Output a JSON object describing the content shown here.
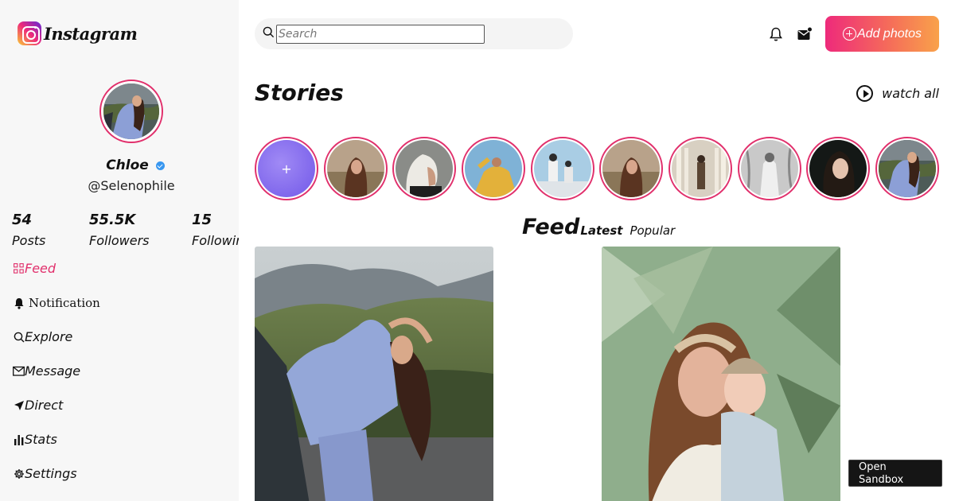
{
  "app": {
    "name": "Instagram"
  },
  "profile": {
    "name": "Chloe",
    "handle": "@Selenophile",
    "verified": true,
    "stats": [
      {
        "value": "54",
        "label": "Posts"
      },
      {
        "value": "55.5K",
        "label": "Followers"
      },
      {
        "value": "15",
        "label": "Following"
      }
    ]
  },
  "nav": [
    {
      "label": "Feed",
      "icon": "grid-icon",
      "active": true
    },
    {
      "label": "Notification",
      "icon": "bell-icon",
      "active": false
    },
    {
      "label": "Explore",
      "icon": "search-icon",
      "active": false
    },
    {
      "label": "Message",
      "icon": "mail-icon",
      "active": false
    },
    {
      "label": "Direct",
      "icon": "send-icon",
      "active": false
    },
    {
      "label": "Stats",
      "icon": "bar-chart-icon",
      "active": false
    },
    {
      "label": "Settings",
      "icon": "gear-icon",
      "active": false
    }
  ],
  "search": {
    "placeholder": "Search",
    "value": ""
  },
  "header": {
    "add_label": "Add photos",
    "icons": [
      "bell-icon",
      "mail-unread-icon",
      "plus-circle-icon"
    ]
  },
  "stories": {
    "title": "Stories",
    "watch_all": "watch all",
    "add_label": "+",
    "count": 10
  },
  "feed": {
    "title": "Feed",
    "tabs": [
      {
        "label": "Latest",
        "active": true
      },
      {
        "label": "Popular",
        "active": false
      }
    ]
  },
  "sandbox": {
    "label": "Open Sandbox"
  },
  "colors": {
    "accent": "#e1306c",
    "gradient_start": "#ee2a7b",
    "gradient_end": "#f9a24a",
    "sidebar_bg": "#f7f7f7",
    "verified": "#3897f0",
    "story_add": "#7258e8"
  }
}
